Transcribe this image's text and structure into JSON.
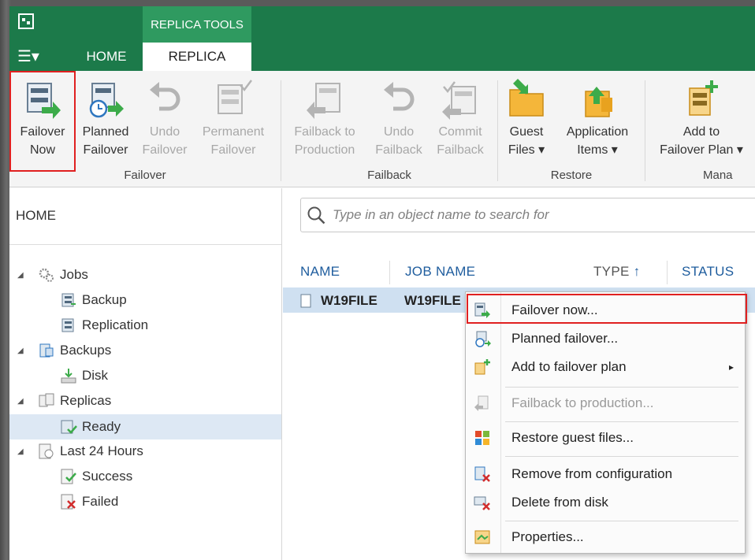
{
  "context_tab": "REPLICA TOOLS",
  "menu_glyph": "☰▾",
  "tabs": {
    "home": "HOME",
    "replica": "REPLICA"
  },
  "ribbon": {
    "failover_now": [
      "Failover",
      "Now"
    ],
    "planned_failover": [
      "Planned",
      "Failover"
    ],
    "undo_failover": [
      "Undo",
      "Failover"
    ],
    "permanent_failover": [
      "Permanent",
      "Failover"
    ],
    "failback_to_production": [
      "Failback to",
      "Production"
    ],
    "undo_failback": [
      "Undo",
      "Failback"
    ],
    "commit_failback": [
      "Commit",
      "Failback"
    ],
    "guest_files": [
      "Guest",
      "Files ▾"
    ],
    "application_items": [
      "Application",
      "Items ▾"
    ],
    "add_to_failover_plan": [
      "Add to",
      "Failover Plan ▾"
    ],
    "groups": {
      "failover": "Failover",
      "failback": "Failback",
      "restore": "Restore",
      "manage": "Mana"
    }
  },
  "sidebar": {
    "header": "HOME",
    "tree": {
      "jobs": "Jobs",
      "backup": "Backup",
      "replication": "Replication",
      "backups": "Backups",
      "disk": "Disk",
      "replicas": "Replicas",
      "ready": "Ready",
      "last24": "Last 24 Hours",
      "success": "Success",
      "failed": "Failed"
    },
    "selected": "Ready"
  },
  "search": {
    "placeholder": "Type in an object name to search for"
  },
  "table": {
    "columns": {
      "name": "NAME",
      "job_name": "JOB NAME",
      "type": "TYPE",
      "type_sort": "↑",
      "status": "STATUS"
    },
    "row": {
      "name": "W19FILE",
      "job_name": "W19FILE"
    }
  },
  "context_menu": {
    "failover_now": "Failover now...",
    "planned_failover": "Planned failover...",
    "add_to_failover_plan": "Add to failover plan",
    "submenu_arrow": "▸",
    "failback_to_production": "Failback to production...",
    "restore_guest_files": "Restore guest files...",
    "remove_from_configuration": "Remove from configuration",
    "delete_from_disk": "Delete from disk",
    "properties": "Properties..."
  },
  "colors": {
    "brand_green": "#1c7a4a",
    "context_green": "#2f9a60",
    "highlight_red": "#e02020",
    "link_blue": "#1f5d9e",
    "selection": "#cfe0f1"
  }
}
